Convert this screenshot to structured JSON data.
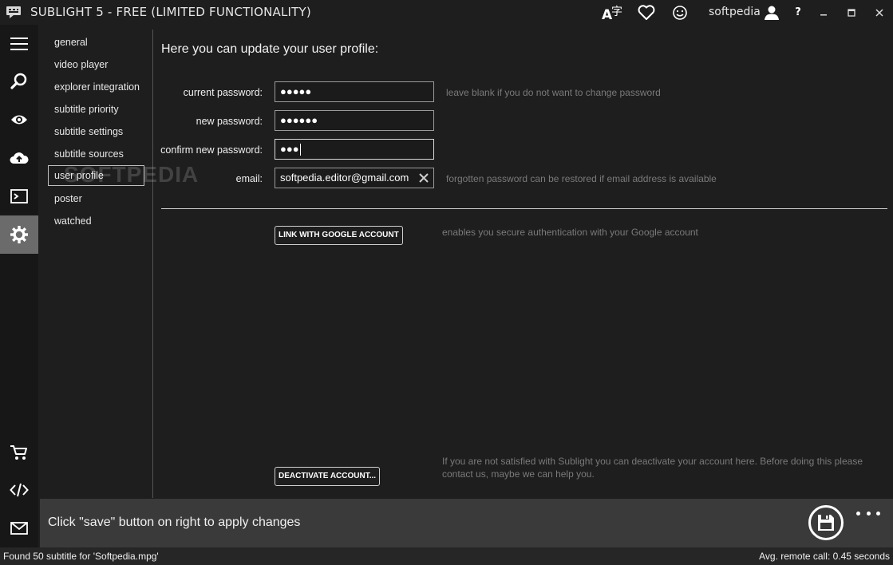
{
  "window": {
    "title": "SUBLIGHT 5 - FREE (LIMITED FUNCTIONALITY)",
    "username": "softpedia",
    "help_label": "?"
  },
  "rail": {
    "items": [
      {
        "icon": "hamburger-menu-icon"
      },
      {
        "icon": "search-icon"
      },
      {
        "icon": "eye-icon"
      },
      {
        "icon": "cloud-upload-icon"
      },
      {
        "icon": "terminal-icon"
      },
      {
        "icon": "gear-icon",
        "active": true
      },
      {
        "icon": "cart-icon"
      },
      {
        "icon": "code-icon"
      },
      {
        "icon": "mail-icon"
      }
    ]
  },
  "nav": {
    "items": [
      {
        "label": "general"
      },
      {
        "label": "video player"
      },
      {
        "label": "explorer integration"
      },
      {
        "label": "subtitle priority"
      },
      {
        "label": "subtitle settings"
      },
      {
        "label": "subtitle sources"
      },
      {
        "label": "user profile",
        "selected": true
      },
      {
        "label": "poster"
      },
      {
        "label": "watched"
      }
    ]
  },
  "watermark": "SOFTPEDIA",
  "profile": {
    "heading": "Here you can update your user profile:",
    "current_password": {
      "label": "current password:",
      "value": "●●●●●",
      "hint": "leave blank if you do not want to change password"
    },
    "new_password": {
      "label": "new password:",
      "value": "●●●●●●"
    },
    "confirm_password": {
      "label": "confirm new password:",
      "value": "●●●"
    },
    "email": {
      "label": "email:",
      "value": "softpedia.editor@gmail.com",
      "hint": "forgotten password can be restored if email address is available"
    },
    "google": {
      "button": "LINK WITH GOOGLE ACCOUNT",
      "hint": "enables you secure authentication with your Google account"
    },
    "deactivate": {
      "button": "DEACTIVATE ACCOUNT...",
      "hint": "If you are not satisfied with Sublight you can deactivate your account here. Before doing this please contact us, maybe we can help you."
    }
  },
  "bottom": {
    "message": "Click \"save\" button on right to apply changes"
  },
  "status": {
    "left": "Found 50 subtitle for 'Softpedia.mpg'",
    "right": "Avg. remote call: 0.45 seconds"
  },
  "colors": {
    "background": "#1e1e1e",
    "rail_active": "#6b6b6b",
    "bottom_bar": "#3a3a3a",
    "hint_text": "#7a7a7a"
  }
}
